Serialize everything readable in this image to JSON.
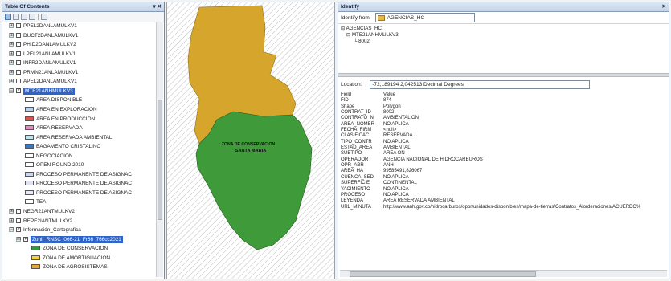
{
  "toc": {
    "title": "Table Of Contents",
    "title_controls": "▾ ✕",
    "layers": [
      {
        "kind": "layer",
        "label": "PPEL2DANLAMULKV1",
        "checked": false,
        "expand": "⊞"
      },
      {
        "kind": "layer",
        "label": "DUCT2DANLAMULKV1",
        "checked": false,
        "expand": "⊞"
      },
      {
        "kind": "layer",
        "label": "PHID2DANLAMULKV2",
        "checked": false,
        "expand": "⊞"
      },
      {
        "kind": "layer",
        "label": "LPEL21ANLAMULKV1",
        "checked": false,
        "expand": "⊞"
      },
      {
        "kind": "layer",
        "label": "INFR2DANLAMULKV1",
        "checked": false,
        "expand": "⊞"
      },
      {
        "kind": "layer",
        "label": "PRMN21ANLAMULKV1",
        "checked": false,
        "expand": "⊞"
      },
      {
        "kind": "layer",
        "label": "APEL2DANLAMULKV1",
        "checked": false,
        "expand": "⊞"
      },
      {
        "kind": "layer",
        "label": "MTE21ANHMULKV3",
        "checked": true,
        "expand": "⊟",
        "selected": true
      },
      {
        "kind": "legend",
        "label": "AREA DISPONIBLE",
        "color": "#ffffff"
      },
      {
        "kind": "legend",
        "label": "AREA EN EXPLORACION",
        "color": "#b9d3ee"
      },
      {
        "kind": "legend",
        "label": "AREA EN PRODUCCION",
        "color": "#d9534f"
      },
      {
        "kind": "legend",
        "label": "AREA RESERVADA",
        "color": "#e88bc2"
      },
      {
        "kind": "legend",
        "label": "AREA RESERVADA AMBIENTAL",
        "color": "#bfe4ee"
      },
      {
        "kind": "legend",
        "label": "BAGAMENTO CRISTALINO",
        "color": "#3a78c4"
      },
      {
        "kind": "legend",
        "label": "NEGOCIACION",
        "color": "#ffffff"
      },
      {
        "kind": "legend",
        "label": "OPEN ROUND 2010",
        "color": "#ffffff"
      },
      {
        "kind": "legend",
        "label": "PROCESO PERMANENTE DE ASIGNAC",
        "color": "#cfd7ee"
      },
      {
        "kind": "legend",
        "label": "PROCESO PERMANENTE DE ASIGNAC",
        "color": "#dde3f4"
      },
      {
        "kind": "legend",
        "label": "PROCESO PERMANENTE DE ASIGNAC",
        "color": "#e7ebf7"
      },
      {
        "kind": "legend",
        "label": "TEA",
        "color": "#ffffff"
      },
      {
        "kind": "layer",
        "label": "NEGR21ANTMULKV2",
        "checked": false,
        "expand": "⊞"
      },
      {
        "kind": "layer",
        "label": "REPE2IANTMULKV2",
        "checked": false,
        "expand": "⊞"
      },
      {
        "kind": "group",
        "label": "Información_Cartografica",
        "checked": true,
        "expand": "⊟"
      },
      {
        "kind": "sublayer",
        "label": "Zonif_RNSC_066-21_Fr66_766cc2021",
        "checked": true,
        "expand": "⊟",
        "selected": true
      },
      {
        "kind": "legend2",
        "label": "ZONA DE CONSERVACION",
        "color": "#2e9e3c"
      },
      {
        "kind": "legend2",
        "label": "ZONA DE AMORTIGUACION",
        "color": "#f1d23a"
      },
      {
        "kind": "legend2",
        "label": "ZONA DE AGROSISTEMAS",
        "color": "#e6a53a"
      }
    ]
  },
  "map": {
    "label_line1": "ZONA DE CONSERVACION",
    "label_line2": "SANTA MARIA",
    "colors": {
      "yellow": "#d5a62b",
      "green": "#3f9a3a",
      "hatch": "#b9b9b9"
    }
  },
  "identify": {
    "title": "Identify",
    "title_controls": "✕",
    "from_label": "Identify from:",
    "from_value": "AGENCIAS_HC",
    "tree": [
      "AGENCIAS_HC",
      "MTE21ANHMULKV3",
      "8002"
    ],
    "location_label": "Location:",
    "location_value": "-72,189194  2,042513 Decimal Degrees",
    "attributes": [
      [
        "Field",
        "Value"
      ],
      [
        "FID",
        "874"
      ],
      [
        "Shape",
        "Polygon"
      ],
      [
        "CONTRAT_ID",
        "8002"
      ],
      [
        "CONTRATO_N",
        "AMBIENTAL ON"
      ],
      [
        "AREA_NOMBR",
        "NO APLICA"
      ],
      [
        "FECHA_FIRM",
        "<null>"
      ],
      [
        "CLASIFICAC",
        "RESERVADA"
      ],
      [
        "TIPO_CONTR",
        "NO APLICA"
      ],
      [
        "ESTAD_AREA",
        "AMBIENTAL"
      ],
      [
        "SUBTIPO",
        "AREA ON"
      ],
      [
        "OPERADOR",
        "AGENCIA NACIONAL DE HIDROCARBUROS"
      ],
      [
        "OPR_ABR",
        "ANH"
      ],
      [
        "AREA_HA",
        "99585491,826067"
      ],
      [
        "CUENCA_SED",
        "NO APLICA"
      ],
      [
        "SUPERFICIE",
        "CONTINENTAL"
      ],
      [
        "YACIMIENTO",
        "NO APLICA"
      ],
      [
        "PROCESO",
        "NO APLICA"
      ],
      [
        "LEYENDA",
        "AREA RESERVADA AMBIENTAL"
      ],
      [
        "URL_MINUTA",
        "http://www.anh.gov.co/hidrocarburos/oportunidades-disponibles/mapa-de-tierras/Contratos_Alorderaciones/ACUERDO%"
      ]
    ]
  }
}
